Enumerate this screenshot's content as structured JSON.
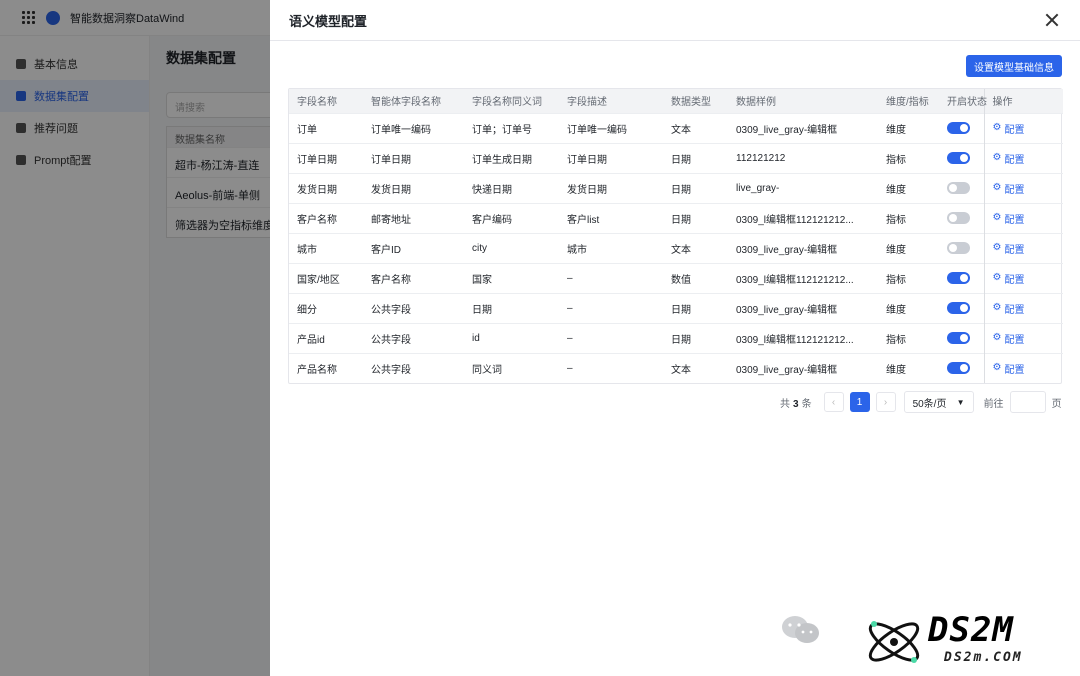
{
  "app": {
    "title": "智能数据洞察DataWind"
  },
  "sidebar": {
    "items": [
      {
        "label": "基本信息",
        "active": false
      },
      {
        "label": "数据集配置",
        "active": true
      },
      {
        "label": "推荐问题",
        "active": false
      },
      {
        "label": "Prompt配置",
        "active": false
      }
    ]
  },
  "background": {
    "title": "数据集配置",
    "search_placeholder": "请搜索",
    "list_header": "数据集名称",
    "list_items": [
      "超市-杨江涛-直连",
      "Aeolus-前端-单侧",
      "筛选器为空指标维度时"
    ]
  },
  "drawer": {
    "title": "语义模型配置",
    "primary_button": "设置模型基础信息",
    "columns": [
      "字段名称",
      "智能体字段名称",
      "字段名称同义词",
      "字段描述",
      "数据类型",
      "数据样例",
      "维度/指标",
      "开启状态",
      "操作"
    ],
    "rows": [
      {
        "name": "订单",
        "agent_name": "订单唯一编码",
        "synonyms": "订单；订单号",
        "desc": "订单唯一编码",
        "type": "文本",
        "sample": "0309_live_gray-编辑框",
        "dim": "维度",
        "enabled": true,
        "action": "配置"
      },
      {
        "name": "订单日期",
        "agent_name": "订单日期",
        "synonyms": "订单生成日期",
        "desc": "订单日期",
        "type": "日期",
        "sample": "112121212",
        "dim": "指标",
        "enabled": true,
        "action": "配置"
      },
      {
        "name": "发货日期",
        "agent_name": "发货日期",
        "synonyms": "快递日期",
        "desc": "发货日期",
        "type": "日期",
        "sample": "live_gray-",
        "dim": "维度",
        "enabled": false,
        "action": "配置"
      },
      {
        "name": "客户名称",
        "agent_name": "邮寄地址",
        "synonyms": "客户编码",
        "desc": "客户list",
        "type": "日期",
        "sample": "0309_l编辑框112121212...",
        "dim": "指标",
        "enabled": false,
        "action": "配置"
      },
      {
        "name": "城市",
        "agent_name": "客户ID",
        "synonyms": "city",
        "desc": "城市",
        "type": "文本",
        "sample": "0309_live_gray-编辑框",
        "dim": "维度",
        "enabled": false,
        "action": "配置"
      },
      {
        "name": "国家/地区",
        "agent_name": "客户名称",
        "synonyms": "国家",
        "desc": "–",
        "type": "数值",
        "sample": "0309_l编辑框112121212...",
        "dim": "指标",
        "enabled": true,
        "action": "配置"
      },
      {
        "name": "细分",
        "agent_name": "公共字段",
        "synonyms": "日期",
        "desc": "–",
        "type": "日期",
        "sample": "0309_live_gray-编辑框",
        "dim": "维度",
        "enabled": true,
        "action": "配置"
      },
      {
        "name": "产品id",
        "agent_name": "公共字段",
        "synonyms": "id",
        "desc": "–",
        "type": "日期",
        "sample": "0309_l编辑框112121212...",
        "dim": "指标",
        "enabled": true,
        "action": "配置"
      },
      {
        "name": "产品名称",
        "agent_name": "公共字段",
        "synonyms": "同义词",
        "desc": "–",
        "type": "文本",
        "sample": "0309_live_gray-编辑框",
        "dim": "维度",
        "enabled": true,
        "action": "配置"
      }
    ],
    "pagination": {
      "total_prefix": "共",
      "total": "3",
      "total_suffix": "条",
      "current_page": "1",
      "page_size": "50条/页",
      "goto_label": "前往",
      "goto_suffix": "页",
      "prev_icon": "chevron-left-icon",
      "next_icon": "chevron-right-icon"
    }
  },
  "watermark": {
    "brand": "DS2M",
    "url": "DS2m.COM"
  },
  "colors": {
    "accent": "#2b64e9",
    "toggle_off": "#c9cdd4",
    "mask": "rgba(0,0,0,0.45)"
  }
}
